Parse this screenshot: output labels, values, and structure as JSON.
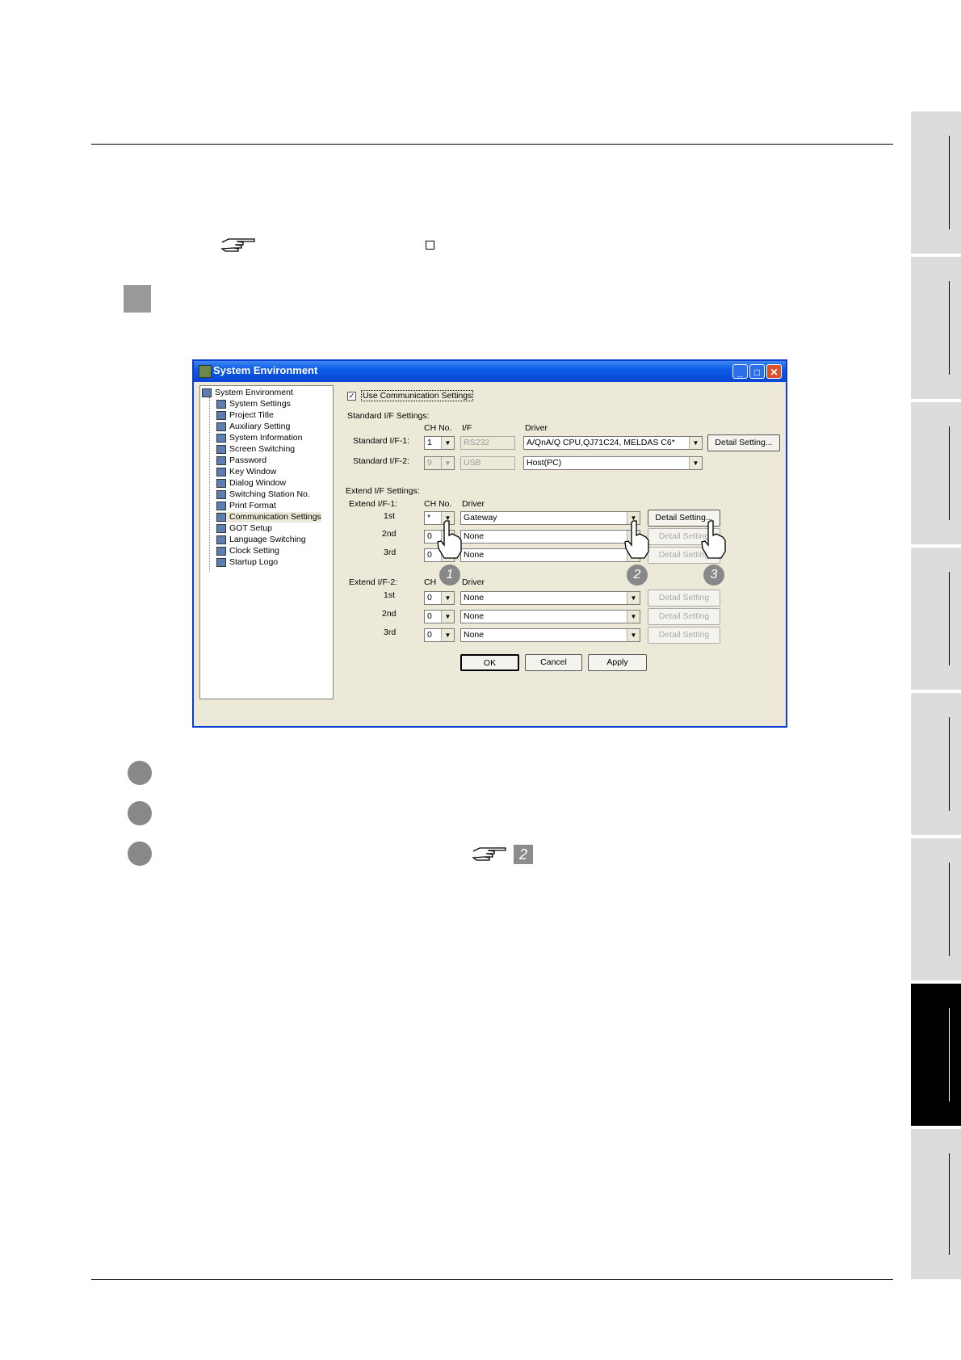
{
  "window": {
    "title": "System Environment",
    "minimize_label": "_",
    "maximize_label": "□",
    "close_label": "✕"
  },
  "tree": {
    "root": "System Environment",
    "items": [
      "System Settings",
      "Project Title",
      "Auxiliary Setting",
      "System Information",
      "Screen Switching",
      "Password",
      "Key Window",
      "Dialog Window",
      "Switching Station No.",
      "Print Format",
      "Communication Settings",
      "GOT Setup",
      "Language Switching",
      "Clock Setting",
      "Startup Logo"
    ],
    "selected": "Communication Settings"
  },
  "settings": {
    "use_comm_label": "Use Communication Settings",
    "use_comm_checked": "✓",
    "standard_heading": "Standard I/F Settings:",
    "col_chno": "CH No.",
    "col_if": "I/F",
    "col_driver": "Driver",
    "std1_label": "Standard I/F-1:",
    "std1_ch": "1",
    "std1_if": "RS232",
    "std1_driver": "A/QnA/Q CPU,QJ71C24, MELDAS C6*",
    "std1_detail": "Detail Setting...",
    "std2_label": "Standard I/F-2:",
    "std2_ch": "9",
    "std2_if": "USB",
    "std2_driver": "Host(PC)",
    "extend_heading": "Extend I/F Settings:",
    "ext1_label": "Extend I/F-1:",
    "ext1_col_chno": "CH No.",
    "ext1_col_driver": "Driver",
    "ext1_rows": [
      {
        "pos": "1st",
        "ch": "*",
        "driver": "Gateway",
        "detail": "Detail Setting..."
      },
      {
        "pos": "2nd",
        "ch": "0",
        "driver": "None",
        "detail": "Detail Setting"
      },
      {
        "pos": "3rd",
        "ch": "0",
        "driver": "None",
        "detail": "Detail Setting"
      }
    ],
    "ext2_label": "Extend I/F-2:",
    "ext2_col_chno": "CH",
    "ext2_col_driver": "Driver",
    "ext2_rows": [
      {
        "pos": "1st",
        "ch": "0",
        "driver": "None",
        "detail": "Detail Setting"
      },
      {
        "pos": "2nd",
        "ch": "0",
        "driver": "None",
        "detail": "Detail Setting"
      },
      {
        "pos": "3rd",
        "ch": "0",
        "driver": "None",
        "detail": "Detail Setting"
      }
    ],
    "ok_label": "OK",
    "cancel_label": "Cancel",
    "apply_label": "Apply"
  },
  "callouts": [
    "1",
    "2",
    "3"
  ],
  "page_ref_number": "2"
}
